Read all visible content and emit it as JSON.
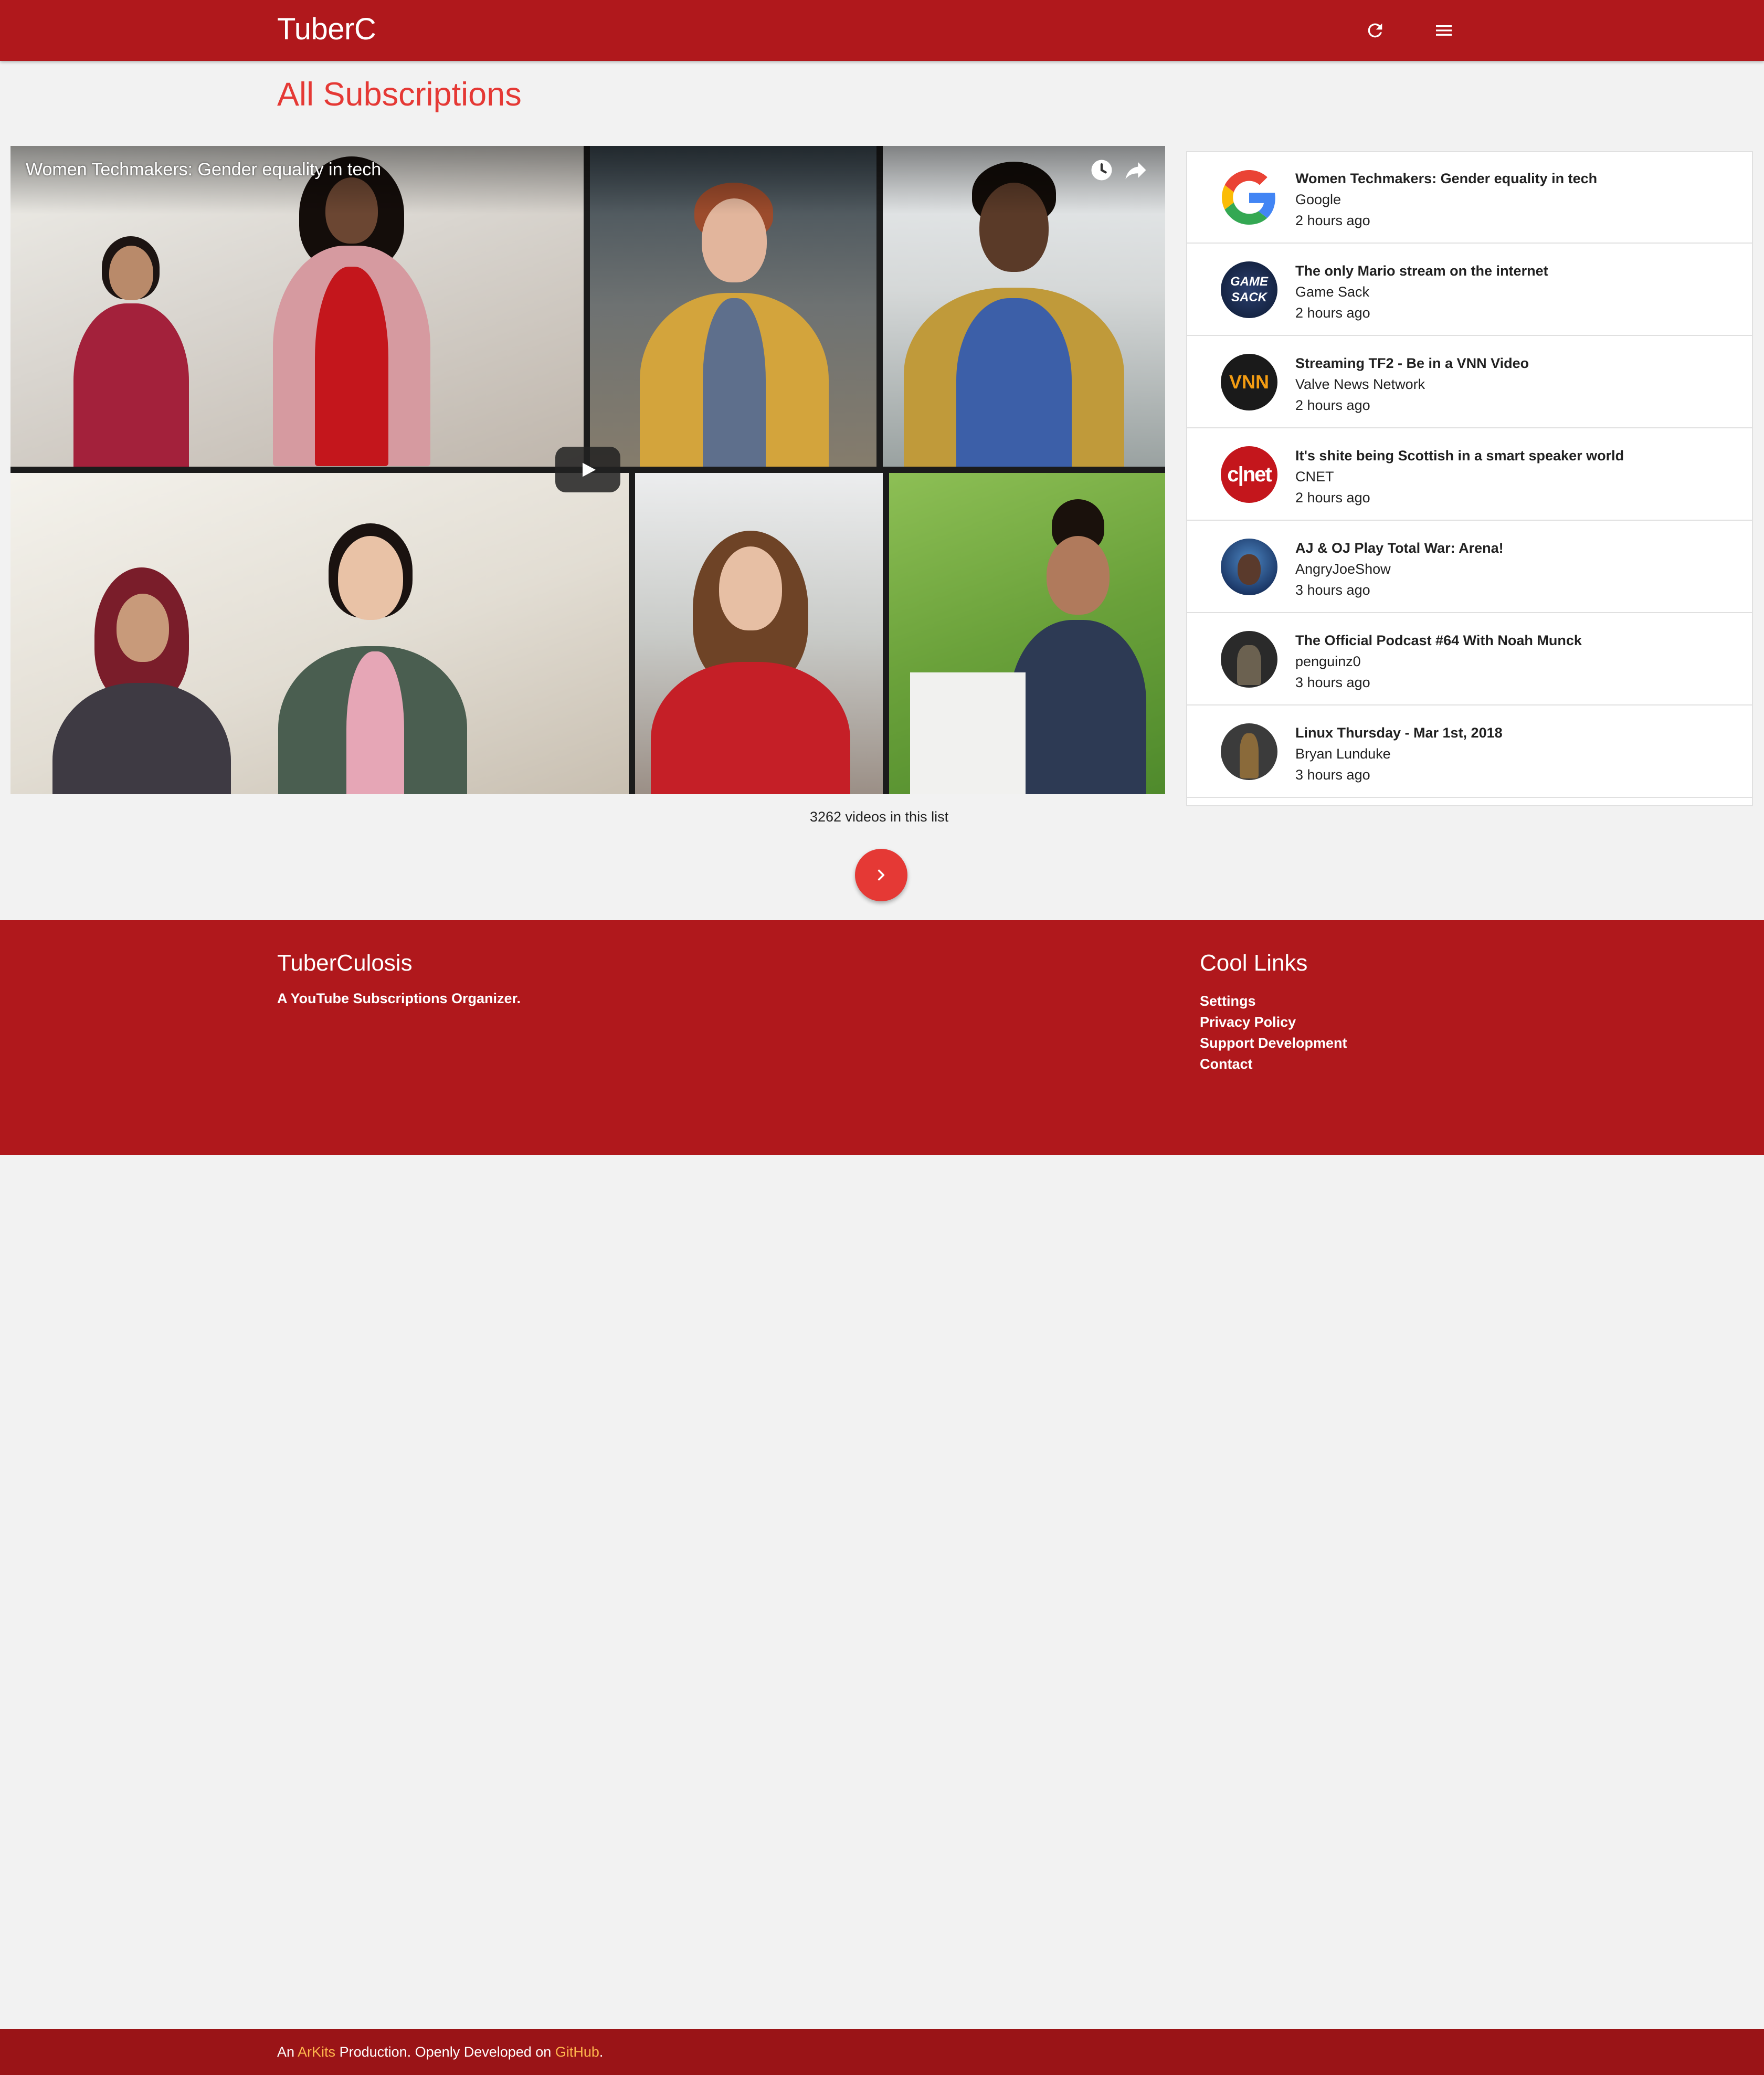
{
  "header": {
    "brand": "TuberC",
    "refresh_icon": "refresh-icon",
    "menu_icon": "menu-icon"
  },
  "page": {
    "title": "All Subscriptions"
  },
  "player": {
    "title": "Women Techmakers: Gender equality in tech",
    "watch_later_icon": "clock-icon",
    "share_icon": "share-icon",
    "play_icon": "play-icon"
  },
  "videos": [
    {
      "title": "Women Techmakers: Gender equality in tech",
      "channel": "Google",
      "time": "2 hours ago",
      "avatar": "google-logo"
    },
    {
      "title": "The only Mario stream on the internet",
      "channel": "Game Sack",
      "time": "2 hours ago",
      "avatar": "game-sack-logo"
    },
    {
      "title": "Streaming TF2 - Be in a VNN Video",
      "channel": "Valve News Network",
      "time": "2 hours ago",
      "avatar": "vnn-logo"
    },
    {
      "title": "It's shite being Scottish in a smart speaker world",
      "channel": "CNET",
      "time": "2 hours ago",
      "avatar": "cnet-logo"
    },
    {
      "title": "AJ & OJ Play Total War: Arena!",
      "channel": "AngryJoeShow",
      "time": "3 hours ago",
      "avatar": "angryjoe-avatar"
    },
    {
      "title": "The Official Podcast #64 With Noah Munck",
      "channel": "penguinz0",
      "time": "3 hours ago",
      "avatar": "penguinz0-avatar"
    },
    {
      "title": "Linux Thursday - Mar 1st, 2018",
      "channel": "Bryan Lunduke",
      "time": "3 hours ago",
      "avatar": "lunduke-avatar"
    }
  ],
  "list_count": "3262 videos in this list",
  "next_icon": "chevron-right-icon",
  "avatar_logos": {
    "game_sack": "GAME SACK",
    "vnn": "VNN",
    "cnet": "c|net"
  },
  "footer": {
    "brand": "TuberCulosis",
    "tagline": "A YouTube Subscriptions Organizer.",
    "links_title": "Cool Links",
    "links": [
      "Settings",
      "Privacy Policy",
      "Support Development",
      "Contact"
    ],
    "copyright": {
      "prefix": "An ",
      "arkits": "ArKits",
      "middle": " Production. Openly Developed on ",
      "github": "GitHub",
      "suffix": "."
    }
  },
  "colors": {
    "primary": "#b0181c",
    "accent": "#e53935",
    "footer_dark": "#9a1417",
    "link_highlight": "#ffb74d"
  }
}
